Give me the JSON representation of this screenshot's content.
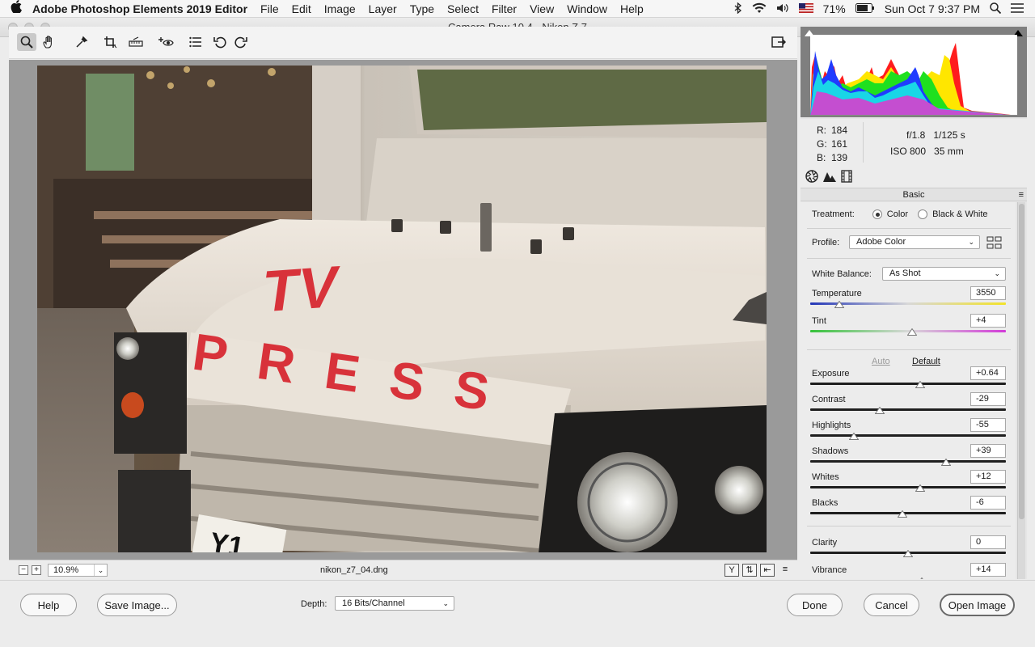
{
  "menubar": {
    "apple": "",
    "app_name": "Adobe Photoshop Elements 2019 Editor",
    "menus": [
      "File",
      "Edit",
      "Image",
      "Layer",
      "Type",
      "Select",
      "Filter",
      "View",
      "Window",
      "Help"
    ],
    "battery": "71%",
    "clock": "Sun Oct 7  9:37 PM"
  },
  "window": {
    "title": "Camera Raw 10.4  -  Nikon Z 7"
  },
  "statusbar": {
    "zoom": "10.9%",
    "filename": "nikon_z7_04.dng"
  },
  "info": {
    "r_label": "R:",
    "r": "184",
    "g_label": "G:",
    "g": "161",
    "b_label": "B:",
    "b": "139",
    "aperture": "f/1.8",
    "shutter": "1/125 s",
    "iso": "ISO 800",
    "focal": "35 mm"
  },
  "panel": {
    "title": "Basic",
    "treatment_label": "Treatment:",
    "treatment_color": "Color",
    "treatment_bw": "Black & White",
    "profile_label": "Profile:",
    "profile_value": "Adobe Color",
    "wb_label": "White Balance:",
    "wb_value": "As Shot",
    "auto": "Auto",
    "default": "Default"
  },
  "sliders": [
    {
      "key": "temperature",
      "label": "Temperature",
      "value": "3550",
      "pos": 0.15,
      "track": "temp"
    },
    {
      "key": "tint",
      "label": "Tint",
      "value": "+4",
      "pos": 0.52,
      "track": "tint"
    },
    {
      "key": "exposure",
      "label": "Exposure",
      "value": "+0.64",
      "pos": 0.56,
      "track": "plain"
    },
    {
      "key": "contrast",
      "label": "Contrast",
      "value": "-29",
      "pos": 0.355,
      "track": "plain"
    },
    {
      "key": "highlights",
      "label": "Highlights",
      "value": "-55",
      "pos": 0.225,
      "track": "plain"
    },
    {
      "key": "shadows",
      "label": "Shadows",
      "value": "+39",
      "pos": 0.695,
      "track": "plain"
    },
    {
      "key": "whites",
      "label": "Whites",
      "value": "+12",
      "pos": 0.56,
      "track": "plain"
    },
    {
      "key": "blacks",
      "label": "Blacks",
      "value": "-6",
      "pos": 0.47,
      "track": "plain"
    },
    {
      "key": "clarity",
      "label": "Clarity",
      "value": "0",
      "pos": 0.5,
      "track": "plain"
    },
    {
      "key": "vibrance",
      "label": "Vibrance",
      "value": "+14",
      "pos": 0.57,
      "track": "plain"
    }
  ],
  "bottom": {
    "help": "Help",
    "save_image": "Save Image...",
    "depth_label": "Depth:",
    "depth_value": "16 Bits/Channel",
    "done": "Done",
    "cancel": "Cancel",
    "open_image": "Open Image"
  },
  "photo": {
    "hood_text_tv": "TV",
    "grille_text": "PRESS",
    "plate": "Y1"
  },
  "colors": {
    "accent": "#2a6fd6",
    "press_red": "#d8323a"
  }
}
